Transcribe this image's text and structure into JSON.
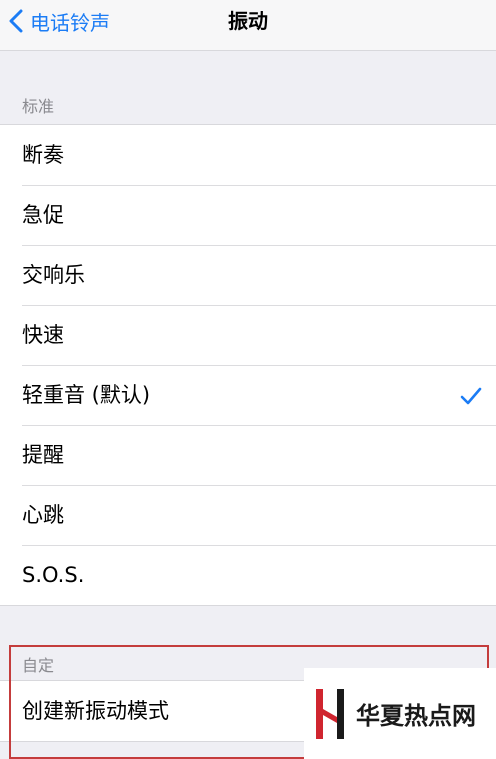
{
  "navbar": {
    "back_label": "电话铃声",
    "title": "振动"
  },
  "sections": {
    "standard": {
      "header": "标准",
      "items": [
        {
          "label": "断奏",
          "selected": false
        },
        {
          "label": "急促",
          "selected": false
        },
        {
          "label": "交响乐",
          "selected": false
        },
        {
          "label": "快速",
          "selected": false
        },
        {
          "label": "轻重音 (默认)",
          "selected": true
        },
        {
          "label": "提醒",
          "selected": false
        },
        {
          "label": "心跳",
          "selected": false
        },
        {
          "label": "S.O.S.",
          "selected": false
        }
      ]
    },
    "custom": {
      "header": "自定",
      "items": [
        {
          "label": "创建新振动模式"
        }
      ]
    }
  },
  "watermark": {
    "text": "华夏热点网"
  },
  "colors": {
    "accent": "#1b7cf5",
    "highlight_border": "#c43c3c",
    "background": "#efeff4"
  },
  "icons": {
    "back": "chevron-left-icon",
    "selected": "checkmark-icon"
  }
}
